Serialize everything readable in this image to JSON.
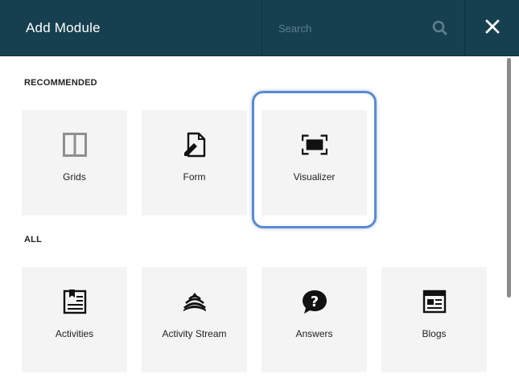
{
  "header": {
    "title": "Add Module",
    "search_placeholder": "Search"
  },
  "sections": {
    "recommended_label": "RECOMMENDED",
    "all_label": "ALL"
  },
  "recommended": [
    {
      "label": "Grids",
      "icon": "grids-icon"
    },
    {
      "label": "Form",
      "icon": "form-icon"
    },
    {
      "label": "Visualizer",
      "icon": "visualizer-icon"
    }
  ],
  "all": [
    {
      "label": "Activities",
      "icon": "activities-icon"
    },
    {
      "label": "Activity Stream",
      "icon": "activity-stream-icon"
    },
    {
      "label": "Answers",
      "icon": "answers-icon"
    },
    {
      "label": "Blogs",
      "icon": "blogs-icon"
    }
  ],
  "colors": {
    "header_bg": "#16404f",
    "tile_bg": "#f4f4f4",
    "highlight": "#5b8bd0"
  }
}
